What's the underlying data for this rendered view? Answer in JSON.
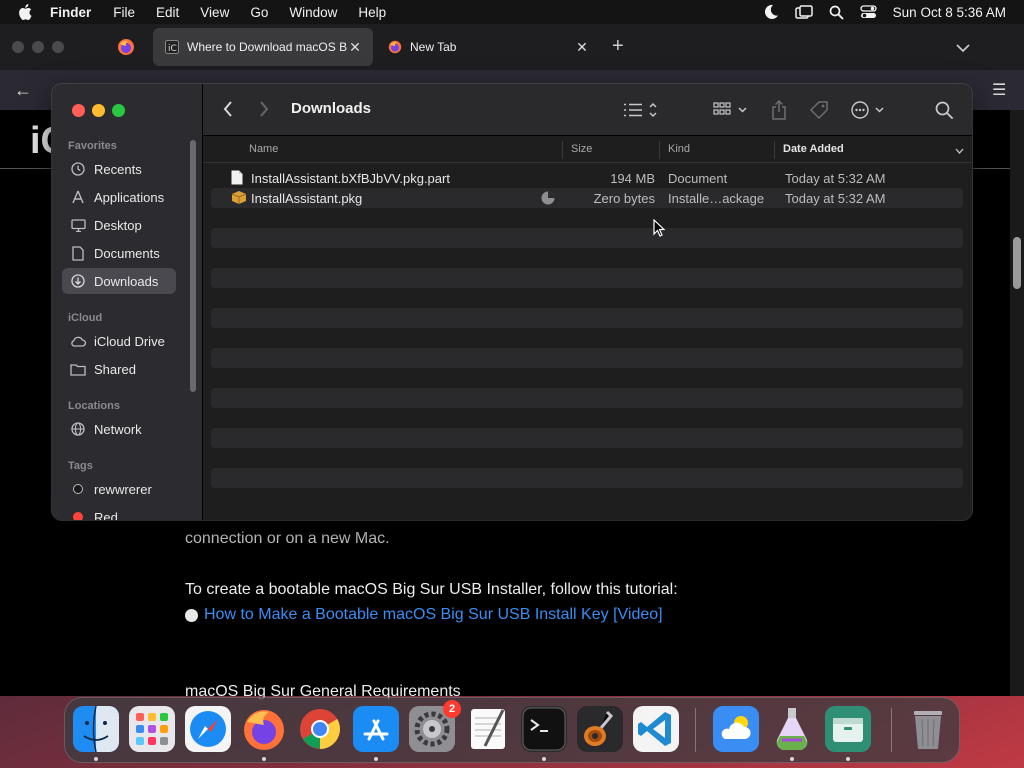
{
  "menubar": {
    "app_name": "Finder",
    "menus": [
      "File",
      "Edit",
      "View",
      "Go",
      "Window",
      "Help"
    ],
    "clock": "Sun Oct 8  5:36 AM"
  },
  "browser": {
    "tabs": [
      {
        "title": "Where to Download macOS Big",
        "favicon": "site-favicon",
        "active": true
      },
      {
        "title": "New Tab",
        "favicon": "firefox-icon",
        "active": false
      }
    ],
    "page": {
      "site_logo": "iC",
      "para_tail": "connection or on a new Mac.",
      "para": "To create a bootable macOS Big Sur USB Installer, follow this tutorial:",
      "link": "How to Make a Bootable macOS Big Sur USB Install Key [Video]",
      "heading": "macOS Big Sur General Requirements"
    }
  },
  "finder": {
    "title": "Downloads",
    "sidebar": {
      "favorites_label": "Favorites",
      "favorites": [
        {
          "label": "Recents",
          "icon": "clock-icon"
        },
        {
          "label": "Applications",
          "icon": "applications-icon"
        },
        {
          "label": "Desktop",
          "icon": "desktop-icon"
        },
        {
          "label": "Documents",
          "icon": "document-icon"
        },
        {
          "label": "Downloads",
          "icon": "download-icon",
          "selected": true
        }
      ],
      "icloud_label": "iCloud",
      "icloud": [
        {
          "label": "iCloud Drive",
          "icon": "cloud-icon"
        },
        {
          "label": "Shared",
          "icon": "shared-folder-icon"
        }
      ],
      "locations_label": "Locations",
      "locations": [
        {
          "label": "Network",
          "icon": "globe-icon"
        }
      ],
      "tags_label": "Tags",
      "tags": [
        {
          "label": "rewwrerer"
        },
        {
          "label": "Red"
        }
      ]
    },
    "columns": {
      "name": "Name",
      "size": "Size",
      "kind": "Kind",
      "date_added": "Date Added"
    },
    "files": [
      {
        "name": "InstallAssistant.bXfBJbVV.pkg.part",
        "size": "194 MB",
        "kind": "Document",
        "date_added": "Today at 5:32 AM",
        "icon": "document-file-icon",
        "downloading": false
      },
      {
        "name": "InstallAssistant.pkg",
        "size": "Zero bytes",
        "kind": "Installe…ackage",
        "date_added": "Today at 5:32 AM",
        "icon": "package-icon",
        "downloading": true
      }
    ]
  },
  "dock": {
    "apps": [
      "finder",
      "launchpad",
      "safari",
      "firefox",
      "chrome",
      "app-store",
      "system-settings",
      "textedit",
      "terminal",
      "garageband",
      "vscode",
      "weather",
      "installer-potion",
      "archive-utility",
      "trash"
    ],
    "system_settings_badge": "2"
  },
  "colors": {
    "accent": "#3a8df3",
    "selection": "#4a4950",
    "badge": "#ff3b30"
  }
}
